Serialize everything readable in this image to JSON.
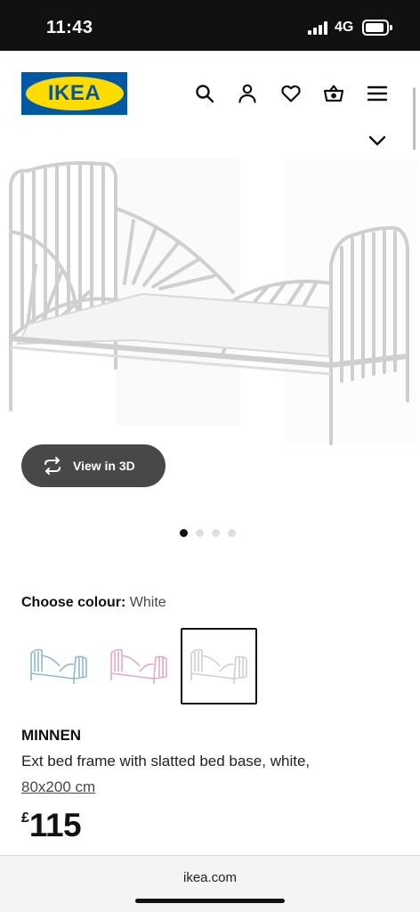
{
  "status_bar": {
    "time": "11:43",
    "network": "4G"
  },
  "header": {
    "logo_text": "IKEA",
    "icons": [
      "search-icon",
      "profile-icon",
      "heart-icon",
      "basket-icon",
      "menu-icon"
    ]
  },
  "gallery": {
    "view_3d_label": "View in 3D",
    "dot_count": 4,
    "active_dot": 1
  },
  "colour": {
    "label": "Choose colour:",
    "value": "White",
    "swatches": [
      {
        "name": "Blue",
        "color": "#8fb9c8"
      },
      {
        "name": "Pink",
        "color": "#e0a9c4"
      },
      {
        "name": "White",
        "color": "#dcdcdc",
        "selected": true
      }
    ]
  },
  "product": {
    "name": "MINNEN",
    "description": "Ext bed frame with slatted bed base, white,",
    "size": "80x200 cm",
    "price_currency": "£",
    "price_amount": "115"
  },
  "browser": {
    "url": "ikea.com"
  },
  "colors": {
    "ikea_blue": "#0058a3",
    "ikea_yellow": "#ffdb00",
    "button_dark": "#484848"
  }
}
